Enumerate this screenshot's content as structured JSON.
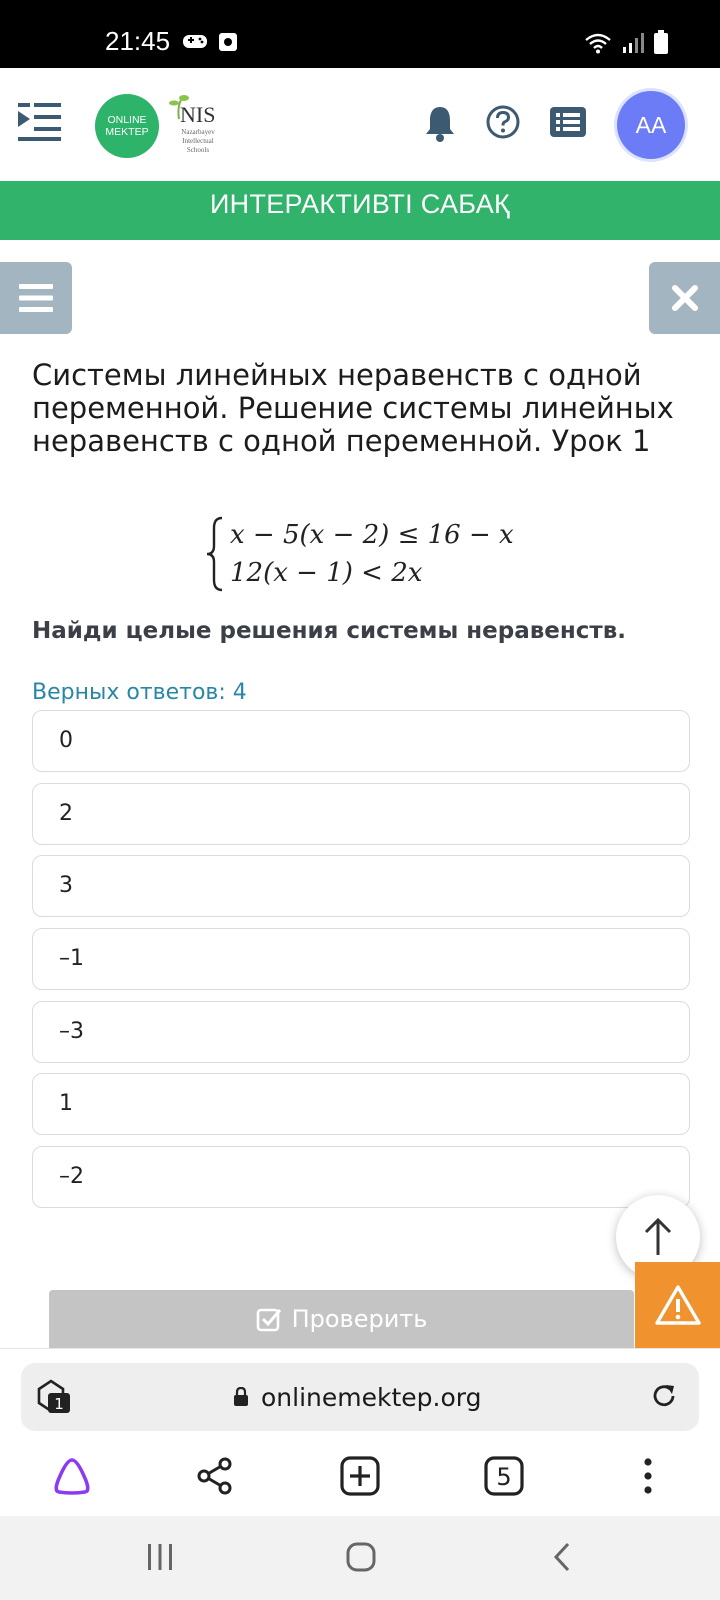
{
  "status_bar": {
    "time": "21:45"
  },
  "header": {
    "logo_line1": "ONLINE",
    "logo_line2": "MEKTEP",
    "nis_title": "NIS",
    "nis_subtitle": "Nazarbayev Intellectual Schools",
    "avatar_initials": "AA"
  },
  "banner": {
    "title": "ИНТЕРАКТИВТІ САБАҚ"
  },
  "lesson": {
    "title": "Системы линейных неравенств с одной переменной. Решение системы линейных неравенств с одной переменной. Урок 1",
    "system_line1": "x − 5(x − 2) ≤ 16 − x",
    "system_line2": "12(x − 1) < 2x",
    "question": "Найди целые решения системы неравенств.",
    "correct_answers_label": "Верных ответов: 4"
  },
  "options": [
    {
      "label": "0"
    },
    {
      "label": "2"
    },
    {
      "label": "3"
    },
    {
      "label": "–1"
    },
    {
      "label": "–3"
    },
    {
      "label": "1"
    },
    {
      "label": "–2"
    }
  ],
  "check_button": {
    "label": "Проверить"
  },
  "browser": {
    "url": "onlinemektep.org",
    "tabs_badge": "1",
    "open_tabs_count": "5"
  },
  "colors": {
    "brand_green": "#32b36b",
    "avatar_blue": "#6b7cf6",
    "warning_orange": "#f0922e",
    "link_blue": "#2a86a8",
    "button_grey": "#a3b5c0"
  },
  "icons": {
    "header": [
      "sidebar-toggle-icon",
      "bell-icon",
      "help-icon",
      "list-icon"
    ],
    "browser_nav": [
      "alice-icon",
      "share-icon",
      "new-tab-icon",
      "tabs-count-icon",
      "more-icon"
    ],
    "system_nav": [
      "recents-icon",
      "home-icon",
      "back-icon"
    ]
  }
}
